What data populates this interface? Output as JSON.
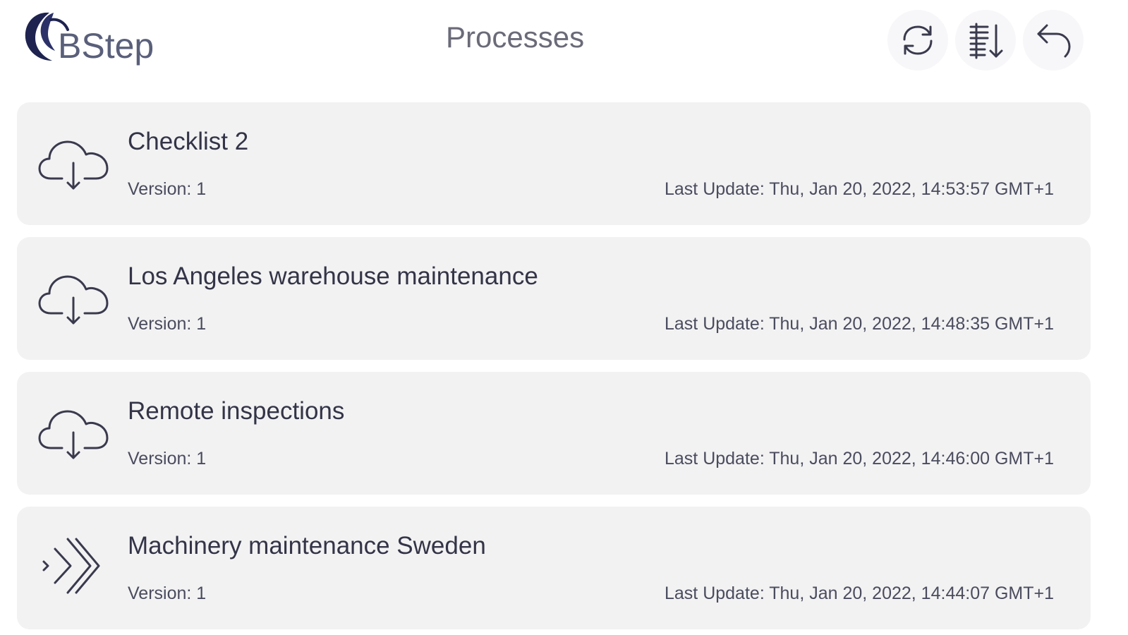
{
  "header": {
    "logo_text": "BStep",
    "title": "Processes",
    "actions": [
      {
        "icon": "refresh-icon"
      },
      {
        "icon": "sort-icon"
      },
      {
        "icon": "back-arrow-icon"
      }
    ]
  },
  "processes": [
    {
      "title": "Checklist 2",
      "version": "Version: 1",
      "last_update": "Last Update: Thu, Jan 20, 2022, 14:53:57 GMT+1",
      "icon": "cloud-download-icon"
    },
    {
      "title": "Los Angeles warehouse maintenance",
      "version": "Version: 1",
      "last_update": "Last Update: Thu, Jan 20, 2022, 14:48:35 GMT+1",
      "icon": "cloud-download-icon"
    },
    {
      "title": "Remote inspections",
      "version": "Version: 1",
      "last_update": "Last Update: Thu, Jan 20, 2022, 14:46:00 GMT+1",
      "icon": "cloud-download-icon"
    },
    {
      "title": "Machinery maintenance Sweden",
      "version": "Version: 1",
      "last_update": "Last Update: Thu, Jan 20, 2022, 14:44:07 GMT+1",
      "icon": "double-chevron-right-icon"
    }
  ],
  "colors": {
    "card_background": "#f2f2f3",
    "logo_dark": "#1e2350",
    "text_primary": "#333447",
    "icon_stroke": "#3a3a4e"
  }
}
